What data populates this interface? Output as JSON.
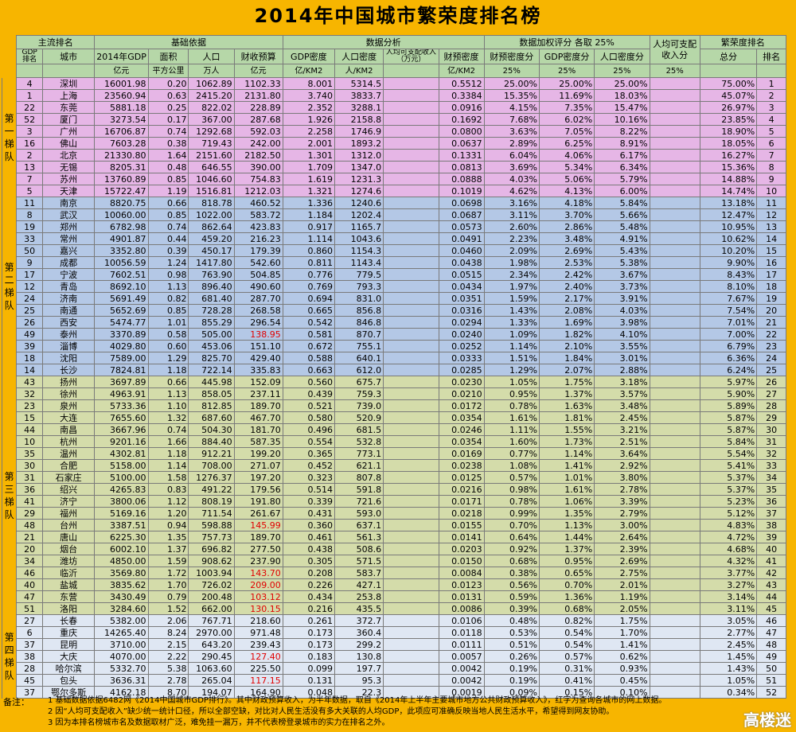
{
  "title": "2014年中国城市繁荣度排名榜",
  "header_row1": [
    "主流排名",
    "基础依据",
    "数据分析",
    "数据加权评分 各取 25%",
    "人均可支配收入分",
    "繁荣度排名"
  ],
  "header_row2": [
    "GDP排名",
    "城市",
    "2014年GDP",
    "面积",
    "人口",
    "财收预算",
    "GDP密度",
    "人口密度",
    "人均可支配收入（万元）",
    "财预密度",
    "财预密度分",
    "GDP密度分",
    "人口密度分",
    "",
    "总分",
    "排名"
  ],
  "header_row3": [
    "",
    "",
    "亿元",
    "平方公里",
    "万人",
    "亿元",
    "亿/KM2",
    "人/KM2",
    "",
    "亿/KM2",
    "25%",
    "25%",
    "25%",
    "25%",
    "",
    ""
  ],
  "tiers": [
    {
      "label": "第一梯队",
      "css": "t1",
      "rows": 10
    },
    {
      "label": "第二梯队",
      "css": "t2",
      "rows": 15
    },
    {
      "label": "第三梯队",
      "css": "t3",
      "rows": 20
    },
    {
      "label": "第四梯队",
      "css": "t4",
      "rows": 7
    }
  ],
  "rows": [
    [
      "4",
      "深圳",
      "16001.98",
      "0.20",
      "1062.89",
      "1102.33",
      "8.001",
      "5314.5",
      "",
      "0.5512",
      "25.00%",
      "25.00%",
      "25.00%",
      "",
      "75.00%",
      "1"
    ],
    [
      "1",
      "上海",
      "23560.94",
      "0.63",
      "2415.20",
      "2131.80",
      "3.740",
      "3833.7",
      "",
      "0.3384",
      "15.35%",
      "11.69%",
      "18.03%",
      "",
      "45.07%",
      "2"
    ],
    [
      "22",
      "东莞",
      "5881.18",
      "0.25",
      "822.02",
      "228.89",
      "2.352",
      "3288.1",
      "",
      "0.0916",
      "4.15%",
      "7.35%",
      "15.47%",
      "",
      "26.97%",
      "3"
    ],
    [
      "52",
      "厦门",
      "3273.54",
      "0.17",
      "367.00",
      "287.68",
      "1.926",
      "2158.8",
      "",
      "0.1692",
      "7.68%",
      "6.02%",
      "10.16%",
      "",
      "23.85%",
      "4"
    ],
    [
      "3",
      "广州",
      "16706.87",
      "0.74",
      "1292.68",
      "592.03",
      "2.258",
      "1746.9",
      "",
      "0.0800",
      "3.63%",
      "7.05%",
      "8.22%",
      "",
      "18.90%",
      "5"
    ],
    [
      "16",
      "佛山",
      "7603.28",
      "0.38",
      "719.43",
      "242.00",
      "2.001",
      "1893.2",
      "",
      "0.0637",
      "2.89%",
      "6.25%",
      "8.91%",
      "",
      "18.05%",
      "6"
    ],
    [
      "2",
      "北京",
      "21330.80",
      "1.64",
      "2151.60",
      "2182.50",
      "1.301",
      "1312.0",
      "",
      "0.1331",
      "6.04%",
      "4.06%",
      "6.17%",
      "",
      "16.27%",
      "7"
    ],
    [
      "13",
      "无锡",
      "8205.31",
      "0.48",
      "646.55",
      "390.00",
      "1.709",
      "1347.0",
      "",
      "0.0813",
      "3.69%",
      "5.34%",
      "6.34%",
      "",
      "15.36%",
      "8"
    ],
    [
      "7",
      "苏州",
      "13760.89",
      "0.85",
      "1046.60",
      "754.83",
      "1.619",
      "1231.3",
      "",
      "0.0888",
      "4.03%",
      "5.06%",
      "5.79%",
      "",
      "14.88%",
      "9"
    ],
    [
      "5",
      "天津",
      "15722.47",
      "1.19",
      "1516.81",
      "1212.03",
      "1.321",
      "1274.6",
      "",
      "0.1019",
      "4.62%",
      "4.13%",
      "6.00%",
      "",
      "14.74%",
      "10"
    ],
    [
      "11",
      "南京",
      "8820.75",
      "0.66",
      "818.78",
      "460.52",
      "1.336",
      "1240.6",
      "",
      "0.0698",
      "3.16%",
      "4.18%",
      "5.84%",
      "",
      "13.18%",
      "11"
    ],
    [
      "8",
      "武汉",
      "10060.00",
      "0.85",
      "1022.00",
      "583.72",
      "1.184",
      "1202.4",
      "",
      "0.0687",
      "3.11%",
      "3.70%",
      "5.66%",
      "",
      "12.47%",
      "12"
    ],
    [
      "19",
      "郑州",
      "6782.98",
      "0.74",
      "862.64",
      "423.83",
      "0.917",
      "1165.7",
      "",
      "0.0573",
      "2.60%",
      "2.86%",
      "5.48%",
      "",
      "10.95%",
      "13"
    ],
    [
      "33",
      "常州",
      "4901.87",
      "0.44",
      "459.20",
      "216.23",
      "1.114",
      "1043.6",
      "",
      "0.0491",
      "2.23%",
      "3.48%",
      "4.91%",
      "",
      "10.62%",
      "14"
    ],
    [
      "50",
      "嘉兴",
      "3352.80",
      "0.39",
      "450.17",
      "179.39",
      "0.860",
      "1154.3",
      "",
      "0.0460",
      "2.09%",
      "2.69%",
      "5.43%",
      "",
      "10.20%",
      "15"
    ],
    [
      "9",
      "成都",
      "10056.59",
      "1.24",
      "1417.80",
      "542.60",
      "0.811",
      "1143.4",
      "",
      "0.0438",
      "1.98%",
      "2.53%",
      "5.38%",
      "",
      "9.90%",
      "16"
    ],
    [
      "17",
      "宁波",
      "7602.51",
      "0.98",
      "763.90",
      "504.85",
      "0.776",
      "779.5",
      "",
      "0.0515",
      "2.34%",
      "2.42%",
      "3.67%",
      "",
      "8.43%",
      "17"
    ],
    [
      "12",
      "青岛",
      "8692.10",
      "1.13",
      "896.40",
      "490.60",
      "0.769",
      "793.3",
      "",
      "0.0434",
      "1.97%",
      "2.40%",
      "3.73%",
      "",
      "8.10%",
      "18"
    ],
    [
      "24",
      "济南",
      "5691.49",
      "0.82",
      "681.40",
      "287.70",
      "0.694",
      "831.0",
      "",
      "0.0351",
      "1.59%",
      "2.17%",
      "3.91%",
      "",
      "7.67%",
      "19"
    ],
    [
      "25",
      "南通",
      "5652.69",
      "0.85",
      "728.28",
      "268.58",
      "0.665",
      "856.8",
      "",
      "0.0316",
      "1.43%",
      "2.08%",
      "4.03%",
      "",
      "7.54%",
      "20"
    ],
    [
      "26",
      "西安",
      "5474.77",
      "1.01",
      "855.29",
      "296.54",
      "0.542",
      "846.8",
      "",
      "0.0294",
      "1.33%",
      "1.69%",
      "3.98%",
      "",
      "7.01%",
      "21"
    ],
    [
      "49",
      "泰州",
      "3370.89",
      "0.58",
      "505.00",
      "138.95",
      "0.581",
      "870.7",
      "",
      "0.0240",
      "1.09%",
      "1.82%",
      "4.10%",
      "",
      "7.00%",
      "22"
    ],
    [
      "39",
      "淄博",
      "4029.80",
      "0.60",
      "453.06",
      "151.10",
      "0.672",
      "755.1",
      "",
      "0.0252",
      "1.14%",
      "2.10%",
      "3.55%",
      "",
      "6.79%",
      "23"
    ],
    [
      "18",
      "沈阳",
      "7589.00",
      "1.29",
      "825.70",
      "429.40",
      "0.588",
      "640.1",
      "",
      "0.0333",
      "1.51%",
      "1.84%",
      "3.01%",
      "",
      "6.36%",
      "24"
    ],
    [
      "14",
      "长沙",
      "7824.81",
      "1.18",
      "722.14",
      "335.83",
      "0.663",
      "612.0",
      "",
      "0.0285",
      "1.29%",
      "2.07%",
      "2.88%",
      "",
      "6.24%",
      "25"
    ],
    [
      "43",
      "扬州",
      "3697.89",
      "0.66",
      "445.98",
      "152.09",
      "0.560",
      "675.7",
      "",
      "0.0230",
      "1.05%",
      "1.75%",
      "3.18%",
      "",
      "5.97%",
      "26"
    ],
    [
      "32",
      "徐州",
      "4963.91",
      "1.13",
      "858.05",
      "237.11",
      "0.439",
      "759.3",
      "",
      "0.0210",
      "0.95%",
      "1.37%",
      "3.57%",
      "",
      "5.90%",
      "27"
    ],
    [
      "23",
      "泉州",
      "5733.36",
      "1.10",
      "812.85",
      "189.70",
      "0.521",
      "739.0",
      "",
      "0.0172",
      "0.78%",
      "1.63%",
      "3.48%",
      "",
      "5.89%",
      "28"
    ],
    [
      "15",
      "大连",
      "7655.60",
      "1.32",
      "687.60",
      "467.70",
      "0.580",
      "520.9",
      "",
      "0.0354",
      "1.61%",
      "1.81%",
      "2.45%",
      "",
      "5.87%",
      "29"
    ],
    [
      "44",
      "南昌",
      "3667.96",
      "0.74",
      "504.30",
      "181.70",
      "0.496",
      "681.5",
      "",
      "0.0246",
      "1.11%",
      "1.55%",
      "3.21%",
      "",
      "5.87%",
      "30"
    ],
    [
      "10",
      "杭州",
      "9201.16",
      "1.66",
      "884.40",
      "587.35",
      "0.554",
      "532.8",
      "",
      "0.0354",
      "1.60%",
      "1.73%",
      "2.51%",
      "",
      "5.84%",
      "31"
    ],
    [
      "35",
      "温州",
      "4302.81",
      "1.18",
      "912.21",
      "199.20",
      "0.365",
      "773.1",
      "",
      "0.0169",
      "0.77%",
      "1.14%",
      "3.64%",
      "",
      "5.54%",
      "32"
    ],
    [
      "30",
      "合肥",
      "5158.00",
      "1.14",
      "708.00",
      "271.07",
      "0.452",
      "621.1",
      "",
      "0.0238",
      "1.08%",
      "1.41%",
      "2.92%",
      "",
      "5.41%",
      "33"
    ],
    [
      "31",
      "石家庄",
      "5100.00",
      "1.58",
      "1276.37",
      "197.20",
      "0.323",
      "807.8",
      "",
      "0.0125",
      "0.57%",
      "1.01%",
      "3.80%",
      "",
      "5.37%",
      "34"
    ],
    [
      "36",
      "绍兴",
      "4265.83",
      "0.83",
      "491.22",
      "179.56",
      "0.514",
      "591.8",
      "",
      "0.0216",
      "0.98%",
      "1.61%",
      "2.78%",
      "",
      "5.37%",
      "35"
    ],
    [
      "41",
      "济宁",
      "3800.06",
      "1.12",
      "808.19",
      "191.80",
      "0.339",
      "721.6",
      "",
      "0.0171",
      "0.78%",
      "1.06%",
      "3.39%",
      "",
      "5.23%",
      "36"
    ],
    [
      "29",
      "福州",
      "5169.16",
      "1.20",
      "711.54",
      "261.67",
      "0.431",
      "593.0",
      "",
      "0.0218",
      "0.99%",
      "1.35%",
      "2.79%",
      "",
      "5.12%",
      "37"
    ],
    [
      "48",
      "台州",
      "3387.51",
      "0.94",
      "598.88",
      "145.99",
      "0.360",
      "637.1",
      "",
      "0.0155",
      "0.70%",
      "1.13%",
      "3.00%",
      "",
      "4.83%",
      "38"
    ],
    [
      "21",
      "唐山",
      "6225.30",
      "1.35",
      "757.73",
      "189.70",
      "0.461",
      "561.3",
      "",
      "0.0141",
      "0.64%",
      "1.44%",
      "2.64%",
      "",
      "4.72%",
      "39"
    ],
    [
      "20",
      "烟台",
      "6002.10",
      "1.37",
      "696.82",
      "277.50",
      "0.438",
      "508.6",
      "",
      "0.0203",
      "0.92%",
      "1.37%",
      "2.39%",
      "",
      "4.68%",
      "40"
    ],
    [
      "34",
      "潍坊",
      "4850.00",
      "1.59",
      "908.62",
      "237.90",
      "0.305",
      "571.5",
      "",
      "0.0150",
      "0.68%",
      "0.95%",
      "2.69%",
      "",
      "4.32%",
      "41"
    ],
    [
      "46",
      "临沂",
      "3569.80",
      "1.72",
      "1003.94",
      "143.70",
      "0.208",
      "583.7",
      "",
      "0.0084",
      "0.38%",
      "0.65%",
      "2.75%",
      "",
      "3.77%",
      "42"
    ],
    [
      "40",
      "盐城",
      "3835.62",
      "1.70",
      "726.02",
      "209.00",
      "0.226",
      "427.1",
      "",
      "0.0123",
      "0.56%",
      "0.70%",
      "2.01%",
      "",
      "3.27%",
      "43"
    ],
    [
      "47",
      "东营",
      "3430.49",
      "0.79",
      "200.48",
      "103.12",
      "0.434",
      "253.8",
      "",
      "0.0131",
      "0.59%",
      "1.36%",
      "1.19%",
      "",
      "3.14%",
      "44"
    ],
    [
      "51",
      "洛阳",
      "3284.60",
      "1.52",
      "662.00",
      "130.15",
      "0.216",
      "435.5",
      "",
      "0.0086",
      "0.39%",
      "0.68%",
      "2.05%",
      "",
      "3.11%",
      "45"
    ],
    [
      "27",
      "长春",
      "5382.00",
      "2.06",
      "767.71",
      "218.60",
      "0.261",
      "372.7",
      "",
      "0.0106",
      "0.48%",
      "0.82%",
      "1.75%",
      "",
      "3.05%",
      "46"
    ],
    [
      "6",
      "重庆",
      "14265.40",
      "8.24",
      "2970.00",
      "971.48",
      "0.173",
      "360.4",
      "",
      "0.0118",
      "0.53%",
      "0.54%",
      "1.70%",
      "",
      "2.77%",
      "47"
    ],
    [
      "37",
      "昆明",
      "3710.00",
      "2.15",
      "643.20",
      "239.43",
      "0.173",
      "299.2",
      "",
      "0.0111",
      "0.51%",
      "0.54%",
      "1.41%",
      "",
      "2.45%",
      "48"
    ],
    [
      "38",
      "大庆",
      "4070.00",
      "2.22",
      "290.45",
      "127.40",
      "0.183",
      "130.8",
      "",
      "0.0057",
      "0.26%",
      "0.57%",
      "0.62%",
      "",
      "1.45%",
      "49"
    ],
    [
      "28",
      "哈尔滨",
      "5332.70",
      "5.38",
      "1063.60",
      "225.50",
      "0.099",
      "197.7",
      "",
      "0.0042",
      "0.19%",
      "0.31%",
      "0.93%",
      "",
      "1.43%",
      "50"
    ],
    [
      "45",
      "包头",
      "3636.31",
      "2.78",
      "265.04",
      "117.15",
      "0.131",
      "95.3",
      "",
      "0.0042",
      "0.19%",
      "0.41%",
      "0.45%",
      "",
      "1.05%",
      "51"
    ],
    [
      "37",
      "鄂尔多斯",
      "4162.18",
      "8.70",
      "194.07",
      "164.90",
      "0.048",
      "22.3",
      "",
      "0.0019",
      "0.09%",
      "0.15%",
      "0.10%",
      "",
      "0.34%",
      "52"
    ]
  ],
  "red_budget_cities": [
    "泰州",
    "台州",
    "临沂",
    "盐城",
    "东营",
    "洛阳",
    "大庆",
    "包头"
  ],
  "notes_label": "备注：",
  "notes": [
    "1 基础数据依据6482网《2014中国城市GDP排行》。其中财政预算收入，为半年数据，取自《2014年上半年主要城市地方公共财政预算收入》，红字为查询各城市的网上数据。",
    "2 因“人均可支配收入”缺少统一统计口径，所以全部空缺，对比对人民生活没有多大关联的人均GDP，此项应可准确反映当地人民生活水平，希望得到网友协助。",
    "3 因为本排名榜城市名及数据取材广泛，难免挂一漏万，并不代表榜登录城市的实力在排名之外。"
  ],
  "logo_text": "高楼迷",
  "colors": {
    "background": "#f7b500",
    "header": "#b6d7a8",
    "tier1": "#e6b6e6",
    "tier2": "#b4c8e6",
    "tier3": "#d4dcaa",
    "tier4": "#dfe7f3",
    "red_text": "#e00000"
  }
}
